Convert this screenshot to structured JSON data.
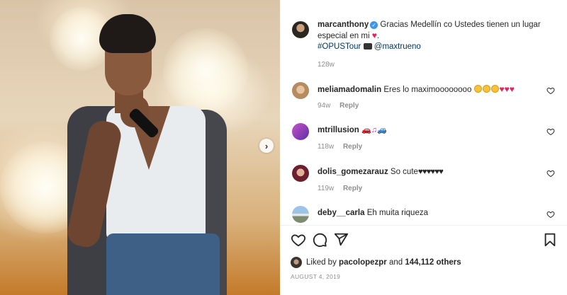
{
  "post": {
    "author": "marcanthony",
    "verified": true,
    "caption_text": "Gracias Medellín co Ustedes tienen un lugar especial en mi",
    "caption_hashtag": "#OPUSTour",
    "caption_mention": "@maxtrueno",
    "caption_age": "128w"
  },
  "media": {
    "next_label": "›",
    "icon": "chevron-right-icon"
  },
  "comments": [
    {
      "user": "meliamadomalin",
      "text": "Eres lo maximoooooooo",
      "age": "94w",
      "reply": "Reply",
      "emoji": [
        "smiling-face",
        "smiling-face",
        "smiling-face",
        "red-heart",
        "red-heart",
        "red-heart"
      ]
    },
    {
      "user": "mtrillusion",
      "text": "",
      "age": "118w",
      "reply": "Reply",
      "emoji": [
        "car",
        "music-notes",
        "car"
      ]
    },
    {
      "user": "dolis_gomezarauz",
      "text": "So cute",
      "hearts": "♥♥♥♥♥♥",
      "age": "119w",
      "reply": "Reply"
    },
    {
      "user": "deby__carla",
      "text": "Eh muita riqueza",
      "age": "",
      "reply": ""
    }
  ],
  "actions": {
    "like_icon": "heart-icon",
    "comment_icon": "comment-icon",
    "share_icon": "send-icon",
    "save_icon": "bookmark-icon"
  },
  "likes": {
    "prefix": "Liked by",
    "user": "pacolopezpr",
    "middle": "and",
    "count": "144,112 others"
  },
  "date": "AUGUST 4, 2019",
  "colors": {
    "link": "#00376b",
    "verified": "#3897f0",
    "meta": "#8e8e8e",
    "heart": "#e0245e"
  }
}
